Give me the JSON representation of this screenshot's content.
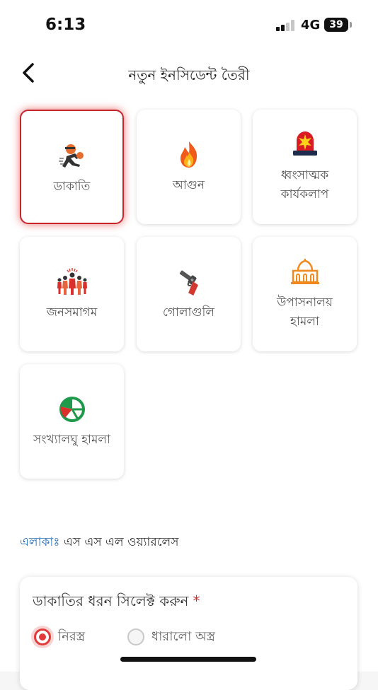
{
  "status": {
    "time": "6:13",
    "network": "4G",
    "battery": "39"
  },
  "header": {
    "title": "নতুন ইনসিডেন্ট তৈরী",
    "back_icon": "chevron-left-icon"
  },
  "categories": [
    {
      "label": "ডাকাতি",
      "icon": "robber-icon",
      "selected": true
    },
    {
      "label": "আগুন",
      "icon": "fire-icon",
      "selected": false
    },
    {
      "label_line1": "ধ্বংসাত্মক",
      "label_line2": "কার্যকলাপ",
      "icon": "siren-icon",
      "selected": false
    },
    {
      "label": "জনসমাগম",
      "icon": "crowd-icon",
      "selected": false
    },
    {
      "label": "গোলাগুলি",
      "icon": "gun-icon",
      "selected": false
    },
    {
      "label_line1": "উপাসনালয়",
      "label_line2": "হামলা",
      "icon": "mosque-icon",
      "selected": false
    },
    {
      "label": "সংখ্যালঘু হামলা",
      "icon": "pie-chart-icon",
      "selected": false
    }
  ],
  "area": {
    "key": "এলাকাঃ",
    "value": " এস এস এল ওয়্যারলেস"
  },
  "form": {
    "label": "ডাকাতির ধরন সিলেক্ট করুন",
    "required_mark": "*",
    "options": [
      {
        "label": "নিরস্ত্র",
        "selected": true
      },
      {
        "label": "ধারালো অস্ত্র",
        "selected": false
      }
    ]
  },
  "colors": {
    "accent": "#c8252b",
    "area_key": "#2a6fb5",
    "radio_active": "#e23a3a"
  }
}
